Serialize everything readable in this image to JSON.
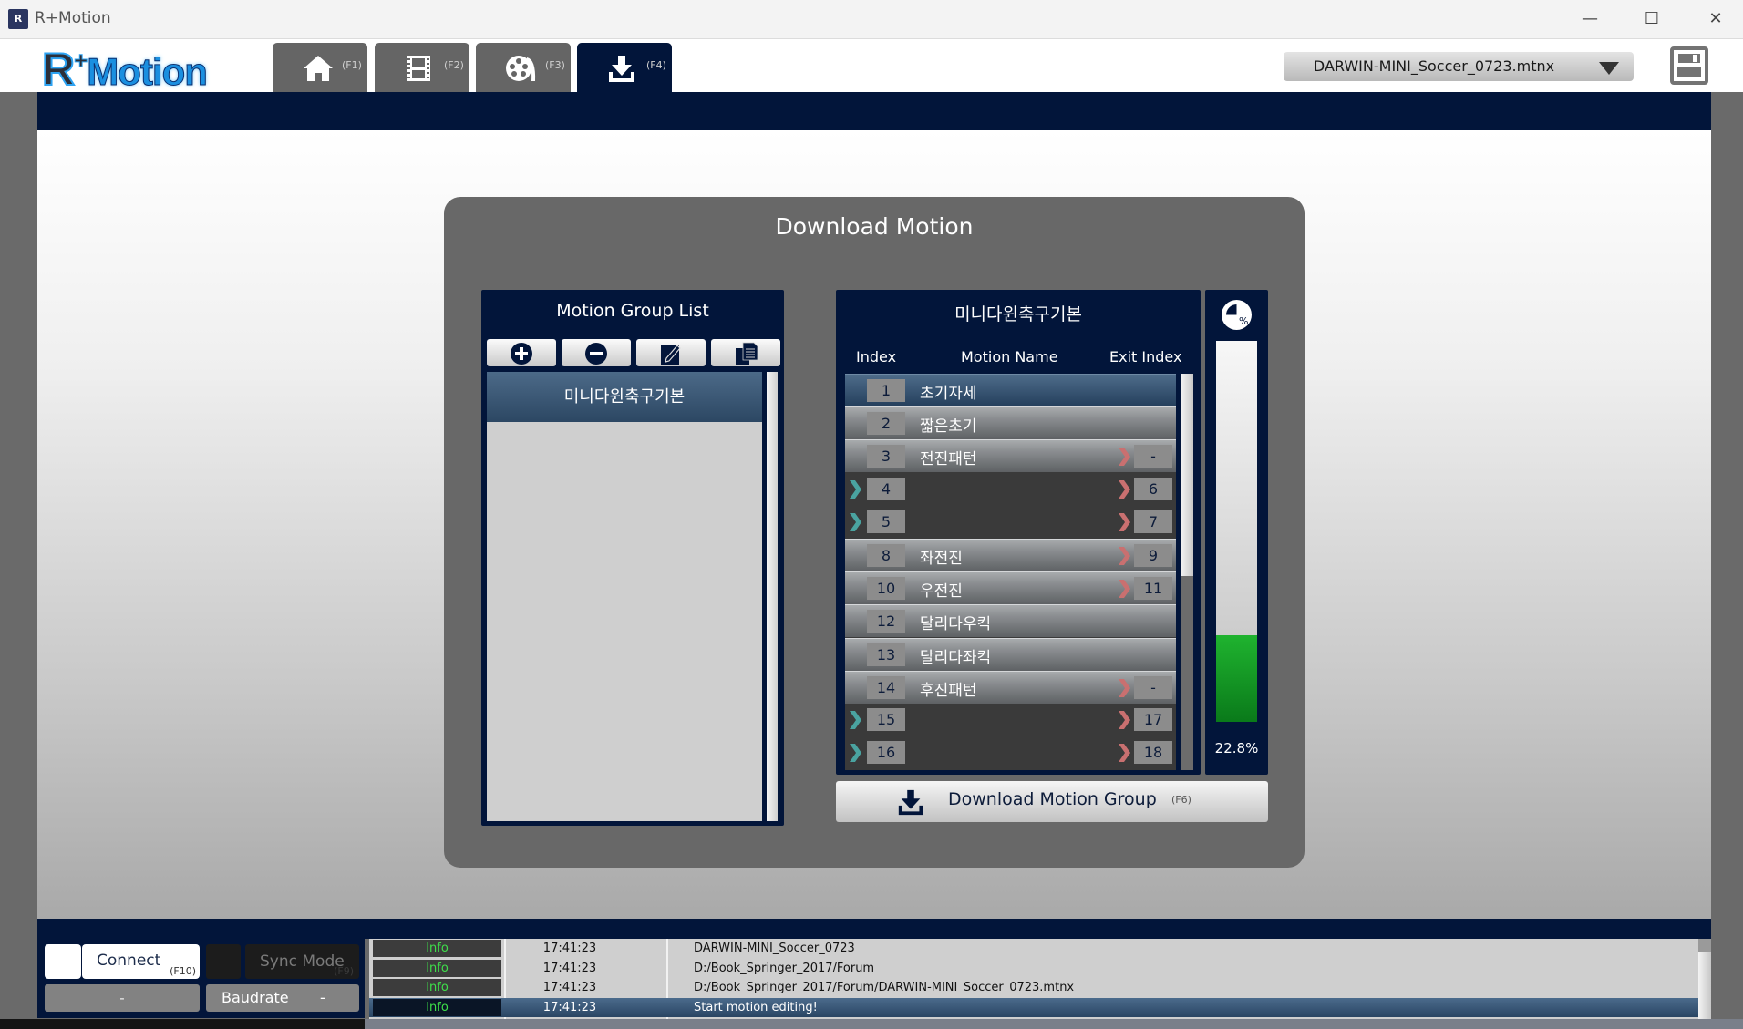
{
  "window": {
    "title": "R+Motion",
    "controls": [
      "minimize",
      "maximize",
      "close"
    ]
  },
  "header": {
    "logo_r": "R",
    "logo_plus": "+",
    "logo_text": "Motion",
    "tabs": [
      {
        "icon": "home-icon",
        "key": "(F1)",
        "active": false
      },
      {
        "icon": "film-icon",
        "key": "(F2)",
        "active": false
      },
      {
        "icon": "film-reel-icon",
        "key": "(F3)",
        "active": false
      },
      {
        "icon": "download-icon",
        "key": "(F4)",
        "active": true
      }
    ],
    "file_select": {
      "value": "DARWIN-MINI_Soccer_0723.mtnx"
    },
    "save_icon": "save-icon"
  },
  "dialog": {
    "title": "Download Motion",
    "group_panel": {
      "title": "Motion Group List",
      "tools": [
        "add-icon",
        "remove-icon",
        "edit-icon",
        "copy-icon"
      ],
      "groups": [
        {
          "name": "미니다윈축구기본",
          "selected": true
        }
      ]
    },
    "motion_panel": {
      "title": "미니다윈축구기본",
      "columns": {
        "index": "Index",
        "name": "Motion Name",
        "exit": "Exit Index"
      },
      "rows": [
        {
          "index": "1",
          "name": "초기자세",
          "exit": "",
          "in_arrow": false,
          "out_arrow": false,
          "type": "selected"
        },
        {
          "index": "2",
          "name": "짧은초기",
          "exit": "",
          "in_arrow": false,
          "out_arrow": false,
          "type": "named"
        },
        {
          "index": "3",
          "name": "전진패턴",
          "exit": "-",
          "in_arrow": false,
          "out_arrow": true,
          "type": "named"
        },
        {
          "index": "4",
          "name": "",
          "exit": "6",
          "in_arrow": true,
          "out_arrow": true,
          "type": "unnamed"
        },
        {
          "index": "5",
          "name": "",
          "exit": "7",
          "in_arrow": true,
          "out_arrow": true,
          "type": "unnamed"
        },
        {
          "index": "8",
          "name": "좌전진",
          "exit": "9",
          "in_arrow": false,
          "out_arrow": true,
          "type": "named"
        },
        {
          "index": "10",
          "name": "우전진",
          "exit": "11",
          "in_arrow": false,
          "out_arrow": true,
          "type": "named"
        },
        {
          "index": "12",
          "name": "달리다우킥",
          "exit": "",
          "in_arrow": false,
          "out_arrow": false,
          "type": "named"
        },
        {
          "index": "13",
          "name": "달리다좌킥",
          "exit": "",
          "in_arrow": false,
          "out_arrow": false,
          "type": "named"
        },
        {
          "index": "14",
          "name": "후진패턴",
          "exit": "-",
          "in_arrow": false,
          "out_arrow": true,
          "type": "named"
        },
        {
          "index": "15",
          "name": "",
          "exit": "17",
          "in_arrow": true,
          "out_arrow": true,
          "type": "unnamed"
        },
        {
          "index": "16",
          "name": "",
          "exit": "18",
          "in_arrow": true,
          "out_arrow": true,
          "type": "unnamed"
        }
      ],
      "scroll_fraction_visible": 0.51
    },
    "memory": {
      "icon": "percent-pie-icon",
      "percent": 22.8,
      "label": "22.8%"
    },
    "download_button": {
      "label": "Download Motion Group",
      "key": "(F6)"
    }
  },
  "status": {
    "connect": {
      "label": "Connect",
      "key": "(F10)"
    },
    "sync": {
      "label": "Sync Mode",
      "key": "(F9)"
    },
    "port": "-",
    "baudrate": {
      "label": "Baudrate",
      "value": "-"
    }
  },
  "log": [
    {
      "level": "Info",
      "time": "17:41:23",
      "message": "DARWIN-MINI_Soccer_0723",
      "selected": false
    },
    {
      "level": "Info",
      "time": "17:41:23",
      "message": "D:/Book_Springer_2017/Forum",
      "selected": false
    },
    {
      "level": "Info",
      "time": "17:41:23",
      "message": "D:/Book_Springer_2017/Forum/DARWIN-MINI_Soccer_0723.mtnx",
      "selected": false
    },
    {
      "level": "Info",
      "time": "17:41:23",
      "message": "Start motion editing!",
      "selected": true
    }
  ],
  "colors": {
    "navy": "#02153a",
    "in_arrow": "#4aa3a0",
    "out_arrow": "#c97070",
    "progress_green": "#16a025",
    "log_level_green": "#3ee04a"
  }
}
